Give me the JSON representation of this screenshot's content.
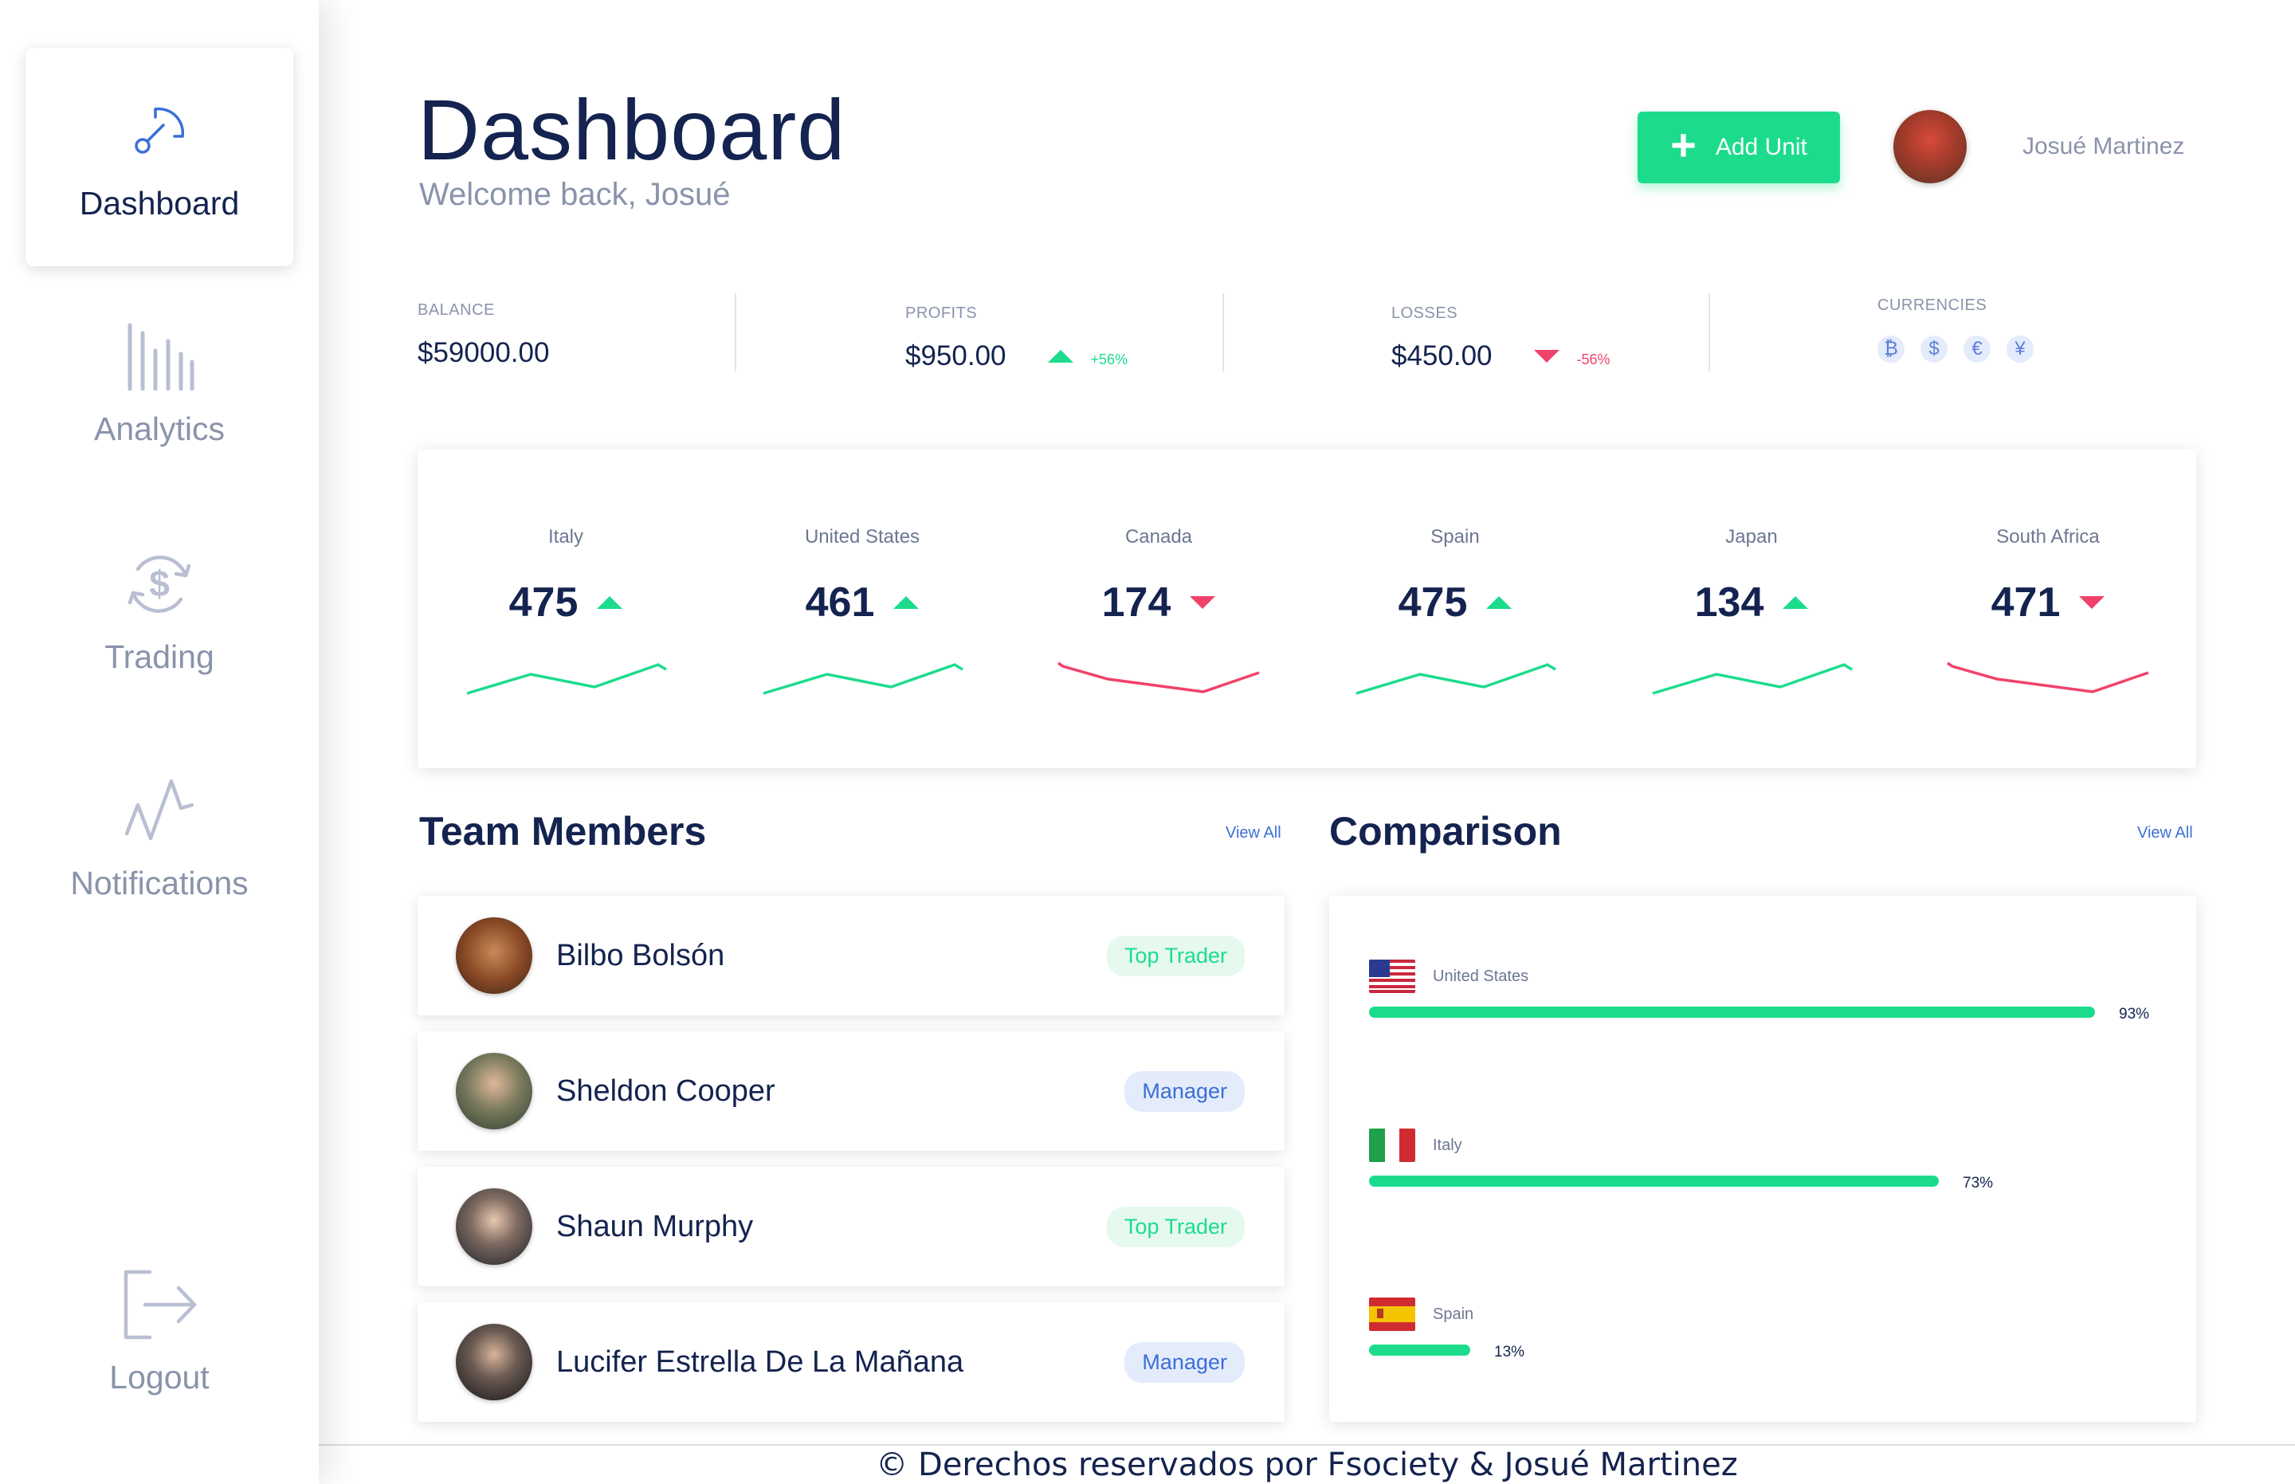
{
  "sidebar": {
    "items": [
      {
        "label": "Dashboard",
        "icon": "gauge-icon",
        "active": true
      },
      {
        "label": "Analytics",
        "icon": "bar-chart-icon",
        "active": false
      },
      {
        "label": "Trading",
        "icon": "dollar-exchange-icon",
        "active": false
      },
      {
        "label": "Notifications",
        "icon": "activity-icon",
        "active": false
      },
      {
        "label": "Logout",
        "icon": "logout-icon",
        "active": false
      }
    ]
  },
  "header": {
    "title": "Dashboard",
    "subtitle": "Welcome back, Josué",
    "add_button": "Add Unit",
    "user_name": "Josué Martinez"
  },
  "stats": {
    "balance": {
      "label": "BALANCE",
      "value": "$59000.00"
    },
    "profits": {
      "label": "PROFITS",
      "value": "$950.00",
      "change": "+56%"
    },
    "losses": {
      "label": "LOSSES",
      "value": "$450.00",
      "change": "-56%"
    },
    "currencies": {
      "label": "CURRENCIES",
      "symbols": [
        "₿",
        "$",
        "€",
        "¥"
      ]
    }
  },
  "countries": [
    {
      "name": "Italy",
      "value": "475",
      "trend": "up"
    },
    {
      "name": "United States",
      "value": "461",
      "trend": "up"
    },
    {
      "name": "Canada",
      "value": "174",
      "trend": "down"
    },
    {
      "name": "Spain",
      "value": "475",
      "trend": "up"
    },
    {
      "name": "Japan",
      "value": "134",
      "trend": "up"
    },
    {
      "name": "South Africa",
      "value": "471",
      "trend": "down"
    }
  ],
  "team": {
    "title": "Team Members",
    "view_all": "View All",
    "members": [
      {
        "name": "Bilbo Bolsón",
        "role": "Top Trader"
      },
      {
        "name": "Sheldon Cooper",
        "role": "Manager"
      },
      {
        "name": "Shaun Murphy",
        "role": "Top Trader"
      },
      {
        "name": "Lucifer Estrella De La Mañana",
        "role": "Manager"
      }
    ]
  },
  "comparison": {
    "title": "Comparison",
    "view_all": "View All",
    "rows": [
      {
        "country": "United States",
        "percent": 93,
        "label": "93%"
      },
      {
        "country": "Italy",
        "percent": 73,
        "label": "73%"
      },
      {
        "country": "Spain",
        "percent": 13,
        "label": "13%"
      }
    ]
  },
  "colors": {
    "accent": "#1cdc8c",
    "negative": "#f0426a",
    "primary_text": "#14234f",
    "muted_text": "#8a93ab",
    "link": "#3b6fd6"
  },
  "footer": "© Derechos reservados por Fsociety & Josué Martinez"
}
